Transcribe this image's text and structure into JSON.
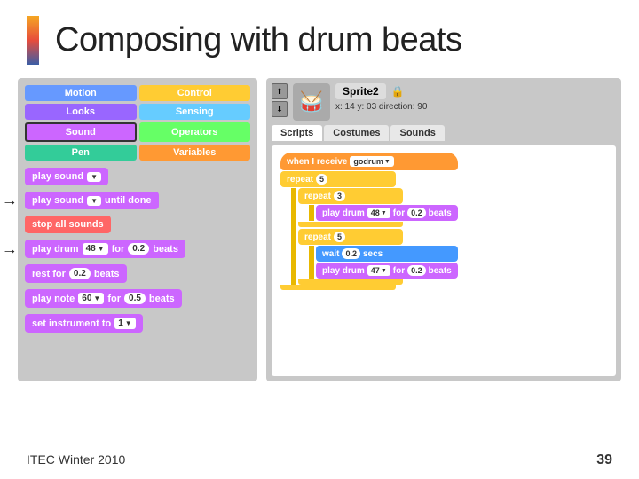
{
  "header": {
    "title": "Composing with drum beats"
  },
  "categories": [
    {
      "label": "Motion",
      "class": "cat-motion"
    },
    {
      "label": "Control",
      "class": "cat-control"
    },
    {
      "label": "Looks",
      "class": "cat-looks"
    },
    {
      "label": "Sensing",
      "class": "cat-sensing"
    },
    {
      "label": "Sound",
      "class": "cat-sound"
    },
    {
      "label": "Operators",
      "class": "cat-operators"
    },
    {
      "label": "Pen",
      "class": "cat-pen"
    },
    {
      "label": "Variables",
      "class": "cat-variables"
    }
  ],
  "left_blocks": [
    {
      "text": "play sound",
      "type": "sound",
      "has_dropdown": true
    },
    {
      "text": "play sound",
      "type": "sound",
      "has_dropdown": true,
      "suffix": "until done"
    },
    {
      "text": "stop all sounds",
      "type": "red"
    },
    {
      "text": "play drum",
      "type": "sound",
      "val1": "48",
      "val2": "0.2",
      "suffix": "beats",
      "has_arrow": true
    },
    {
      "text": "rest for",
      "type": "sound",
      "val1": "0.2",
      "suffix": "beats"
    },
    {
      "text": "play note",
      "type": "sound",
      "val1": "60",
      "val2": "0.5",
      "suffix": "beats"
    },
    {
      "text": "set instrument to",
      "type": "sound",
      "val1": "1"
    }
  ],
  "sprite": {
    "name": "Sprite2",
    "x": "14",
    "y": "03",
    "direction": "90",
    "coords_label": "x: 14  y: 03  direction: 90"
  },
  "tabs": [
    "Scripts",
    "Costumes",
    "Sounds"
  ],
  "active_tab": "Scripts",
  "script": {
    "receive_label": "when I receive",
    "receive_val": "godrum",
    "repeat1_label": "repeat",
    "repeat1_val": "5",
    "repeat2_label": "repeat",
    "repeat2_val": "3",
    "drum1_label": "play drum",
    "drum1_val1": "48",
    "drum1_val2": "0.2",
    "beats1": "beats",
    "repeat3_label": "repeat",
    "repeat3_val": "5",
    "wait_label": "wait",
    "wait_val": "0.2",
    "secs": "secs",
    "drum2_label": "play drum",
    "drum2_val1": "47",
    "drum2_val2": "0.2",
    "beats2": "beats"
  },
  "footer": {
    "course": "ITEC Winter 2010",
    "page": "39"
  },
  "arrows": {
    "arrow1_label": "play sound done",
    "arrow2_label": "play drum"
  }
}
